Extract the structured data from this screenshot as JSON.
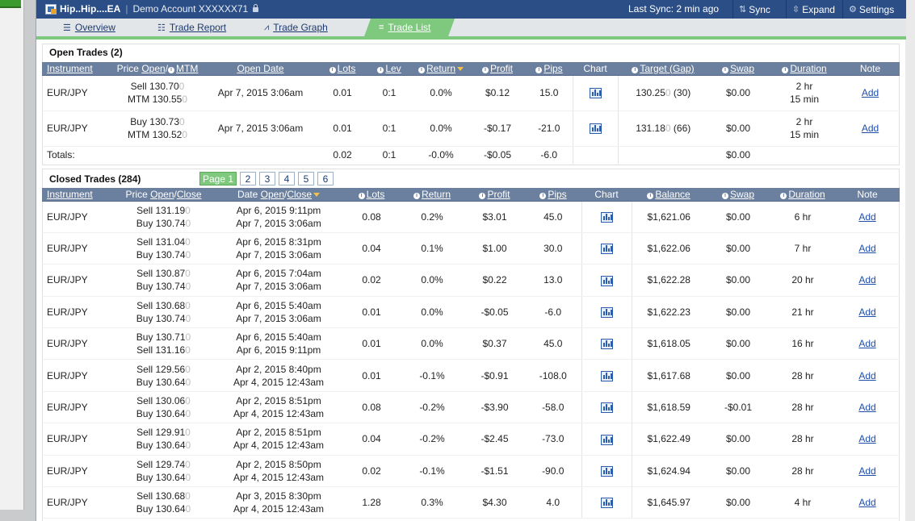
{
  "header": {
    "app_name": "Hip..Hip....EA",
    "account": "Demo Account XXXXXX71",
    "last_sync": "Last Sync: 2 min ago",
    "sync_label": "Sync",
    "expand_label": "Expand",
    "settings_label": "Settings"
  },
  "tabs": {
    "overview": "Overview",
    "report": "Trade Report",
    "graph": "Trade Graph",
    "list": "Trade List"
  },
  "open_trades": {
    "title": "Open Trades (2)",
    "headers": {
      "instrument": "Instrument",
      "price_pre": "Price ",
      "price_open": "Open",
      "price_slash": "/",
      "price_mtm": "MTM",
      "open_date": "Open Date",
      "lots": "Lots",
      "lev": "Lev",
      "return": "Return",
      "profit": "Profit",
      "pips": "Pips",
      "chart": "Chart",
      "target": "Target (Gap)",
      "swap": "Swap",
      "duration": "Duration",
      "note": "Note"
    },
    "rows": [
      {
        "instrument": "EUR/JPY",
        "p1": "Sell 130.70",
        "p1t": "0",
        "p2": "MTM 130.55",
        "p2t": "0",
        "date": "Apr 7, 2015 3:06am",
        "lots": "0.01",
        "lev": "0:1",
        "ret": "0.0%",
        "profit": "$0.12",
        "pips": "15.0",
        "t1": "130.25",
        "tt": "0",
        "t2": " (30)",
        "swap": "$0.00",
        "d1": "2 hr",
        "d2": "15 min",
        "note": "Add"
      },
      {
        "instrument": "EUR/JPY",
        "p1": "Buy 130.73",
        "p1t": "0",
        "p2": "MTM 130.52",
        "p2t": "0",
        "date": "Apr 7, 2015 3:06am",
        "lots": "0.01",
        "lev": "0:1",
        "ret": "0.0%",
        "profit": "-$0.17",
        "pips": "-21.0",
        "t1": "131.18",
        "tt": "0",
        "t2": " (66)",
        "swap": "$0.00",
        "d1": "2 hr",
        "d2": "15 min",
        "note": "Add"
      }
    ],
    "totals": {
      "label": "Totals:",
      "lots": "0.02",
      "lev": "0:1",
      "ret": "-0.0%",
      "profit": "-$0.05",
      "pips": "-6.0",
      "swap": "$0.00"
    }
  },
  "closed_trades": {
    "title": "Closed Trades (284)",
    "pages": [
      "Page 1",
      "2",
      "3",
      "4",
      "5",
      "6"
    ],
    "headers": {
      "instrument": "Instrument",
      "price_pre": "Price ",
      "price_open": "Open",
      "price_slash": "/",
      "price_close": "Close",
      "date_pre": "Date ",
      "date_open": "Open",
      "date_slash": "/",
      "date_close": "Close",
      "lots": "Lots",
      "return": "Return",
      "profit": "Profit",
      "pips": "Pips",
      "chart": "Chart",
      "balance": "Balance",
      "swap": "Swap",
      "duration": "Duration",
      "note": "Note"
    },
    "rows": [
      {
        "instrument": "EUR/JPY",
        "p1": "Sell 131.19",
        "p1t": "0",
        "p2": "Buy 130.74",
        "p2t": "0",
        "d1": "Apr 6, 2015 9:11pm",
        "d2": "Apr 7, 2015 3:06am",
        "lots": "0.08",
        "ret": "0.2%",
        "profit": "$3.01",
        "pips": "45.0",
        "balance": "$1,621.06",
        "swap": "$0.00",
        "duration": "6 hr",
        "note": "Add"
      },
      {
        "instrument": "EUR/JPY",
        "p1": "Sell 131.04",
        "p1t": "0",
        "p2": "Buy 130.74",
        "p2t": "0",
        "d1": "Apr 6, 2015 8:31pm",
        "d2": "Apr 7, 2015 3:06am",
        "lots": "0.04",
        "ret": "0.1%",
        "profit": "$1.00",
        "pips": "30.0",
        "balance": "$1,622.06",
        "swap": "$0.00",
        "duration": "7 hr",
        "note": "Add"
      },
      {
        "instrument": "EUR/JPY",
        "p1": "Sell 130.87",
        "p1t": "0",
        "p2": "Buy 130.74",
        "p2t": "0",
        "d1": "Apr 6, 2015 7:04am",
        "d2": "Apr 7, 2015 3:06am",
        "lots": "0.02",
        "ret": "0.0%",
        "profit": "$0.22",
        "pips": "13.0",
        "balance": "$1,622.28",
        "swap": "$0.00",
        "duration": "20 hr",
        "note": "Add"
      },
      {
        "instrument": "EUR/JPY",
        "p1": "Sell 130.68",
        "p1t": "0",
        "p2": "Buy 130.74",
        "p2t": "0",
        "d1": "Apr 6, 2015 5:40am",
        "d2": "Apr 7, 2015 3:06am",
        "lots": "0.01",
        "ret": "0.0%",
        "profit": "-$0.05",
        "pips": "-6.0",
        "balance": "$1,622.23",
        "swap": "$0.00",
        "duration": "21 hr",
        "note": "Add"
      },
      {
        "instrument": "EUR/JPY",
        "p1": "Buy 130.71",
        "p1t": "0",
        "p2": "Sell 131.16",
        "p2t": "0",
        "d1": "Apr 6, 2015 5:40am",
        "d2": "Apr 6, 2015 9:11pm",
        "lots": "0.01",
        "ret": "0.0%",
        "profit": "$0.37",
        "pips": "45.0",
        "balance": "$1,618.05",
        "swap": "$0.00",
        "duration": "16 hr",
        "note": "Add"
      },
      {
        "instrument": "EUR/JPY",
        "p1": "Sell 129.56",
        "p1t": "0",
        "p2": "Buy 130.64",
        "p2t": "0",
        "d1": "Apr 2, 2015 8:40pm",
        "d2": "Apr 4, 2015 12:43am",
        "lots": "0.01",
        "ret": "-0.1%",
        "profit": "-$0.91",
        "pips": "-108.0",
        "balance": "$1,617.68",
        "swap": "$0.00",
        "duration": "28 hr",
        "note": "Add"
      },
      {
        "instrument": "EUR/JPY",
        "p1": "Sell 130.06",
        "p1t": "0",
        "p2": "Buy 130.64",
        "p2t": "0",
        "d1": "Apr 2, 2015 8:51pm",
        "d2": "Apr 4, 2015 12:43am",
        "lots": "0.08",
        "ret": "-0.2%",
        "profit": "-$3.90",
        "pips": "-58.0",
        "balance": "$1,618.59",
        "swap": "-$0.01",
        "duration": "28 hr",
        "note": "Add"
      },
      {
        "instrument": "EUR/JPY",
        "p1": "Sell 129.91",
        "p1t": "0",
        "p2": "Buy 130.64",
        "p2t": "0",
        "d1": "Apr 2, 2015 8:51pm",
        "d2": "Apr 4, 2015 12:43am",
        "lots": "0.04",
        "ret": "-0.2%",
        "profit": "-$2.45",
        "pips": "-73.0",
        "balance": "$1,622.49",
        "swap": "$0.00",
        "duration": "28 hr",
        "note": "Add"
      },
      {
        "instrument": "EUR/JPY",
        "p1": "Sell 129.74",
        "p1t": "0",
        "p2": "Buy 130.64",
        "p2t": "0",
        "d1": "Apr 2, 2015 8:50pm",
        "d2": "Apr 4, 2015 12:43am",
        "lots": "0.02",
        "ret": "-0.1%",
        "profit": "-$1.51",
        "pips": "-90.0",
        "balance": "$1,624.94",
        "swap": "$0.00",
        "duration": "28 hr",
        "note": "Add"
      },
      {
        "instrument": "EUR/JPY",
        "p1": "Sell 130.68",
        "p1t": "0",
        "p2": "Buy 130.64",
        "p2t": "0",
        "d1": "Apr 3, 2015 8:30pm",
        "d2": "Apr 4, 2015 12:43am",
        "lots": "1.28",
        "ret": "0.3%",
        "profit": "$4.30",
        "pips": "4.0",
        "balance": "$1,645.97",
        "swap": "$0.00",
        "duration": "4 hr",
        "note": "Add"
      }
    ]
  },
  "colors": {
    "header_bg": "#2b4e86",
    "table_header": "#6b7f9e",
    "accent_green": "#7ec97e",
    "positive": "#2a9a2a",
    "negative": "#cc1e1e"
  },
  "icons": {
    "app": "app-window-icon",
    "lock": "lock-icon",
    "sync": "sync-icon",
    "expand": "expand-icon",
    "settings": "gear-icon",
    "overview": "overview-icon",
    "report": "list-icon",
    "graph": "line-chart-icon",
    "list": "list-lines-icon",
    "chart": "bar-chart-icon",
    "info": "info-icon",
    "sort": "sort-down-icon"
  }
}
